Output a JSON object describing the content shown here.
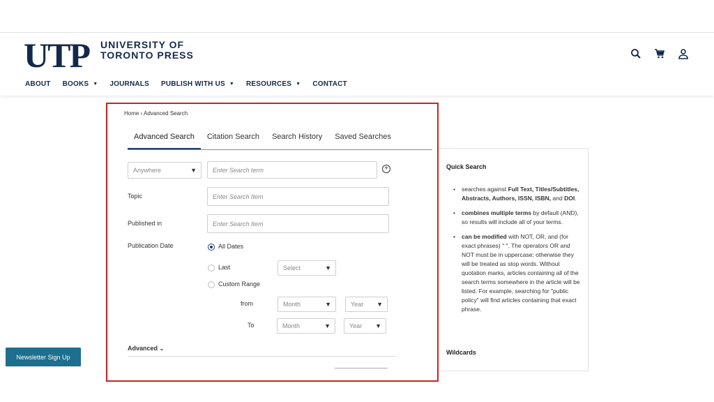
{
  "brand": {
    "mark": "UTP",
    "line1": "UNIVERSITY OF",
    "line2": "TORONTO PRESS"
  },
  "nav": [
    {
      "label": "ABOUT",
      "dropdown": false
    },
    {
      "label": "BOOKS",
      "dropdown": true
    },
    {
      "label": "JOURNALS",
      "dropdown": false
    },
    {
      "label": "PUBLISH WITH US",
      "dropdown": true
    },
    {
      "label": "RESOURCES",
      "dropdown": true
    },
    {
      "label": "CONTACT",
      "dropdown": false
    }
  ],
  "breadcrumb": "Home › Advanced Search",
  "tabs": [
    "Advanced Search",
    "Citation Search",
    "Search History",
    "Saved Searches"
  ],
  "form": {
    "scope_select": "Anywhere",
    "term_placeholder": "Enter Search term",
    "topic_label": "Topic",
    "topic_placeholder": "Enter Search Item",
    "published_label": "Published in",
    "published_placeholder": "Enter Search Item",
    "date_label": "Publication Date",
    "all_dates": "All Dates",
    "last": "Last",
    "last_select": "Select",
    "custom_range": "Custom Range",
    "from": "from",
    "to": "To",
    "month": "Month",
    "year": "Year",
    "advanced": "Advanced"
  },
  "quick_search": {
    "title": "Quick Search",
    "items": [
      {
        "bold_lead": "",
        "text_pre": "searches against ",
        "bold": "Full Text, Titles/Subtitles, Abstracts, Authors, ISSN, ISBN,",
        "text_mid": " and ",
        "bold2": "DOI",
        "text_post": "."
      },
      {
        "bold_lead": "combines multiple terms",
        "text_pre": " by default (AND), so results will include all of your terms.",
        "bold": "",
        "text_mid": "",
        "bold2": "",
        "text_post": ""
      },
      {
        "bold_lead": "can be modified",
        "text_pre": " with NOT, OR, and (for exact phrases) \" \". The operators OR and NOT must be in uppercase; otherwise they will be treated as stop words. Without quotation marks, articles containing all of the search terms somewhere in the article will be listed. For example, searching for \"public policy\" will find articles containing that exact phrase.",
        "bold": "",
        "text_mid": "",
        "bold2": "",
        "text_post": ""
      }
    ],
    "wildcards": "Wildcards"
  },
  "newsletter": "Newsletter Sign Up",
  "colors": {
    "navy": "#13294b",
    "highlight": "#d21f1f",
    "newsletter": "#1e6f8e"
  }
}
